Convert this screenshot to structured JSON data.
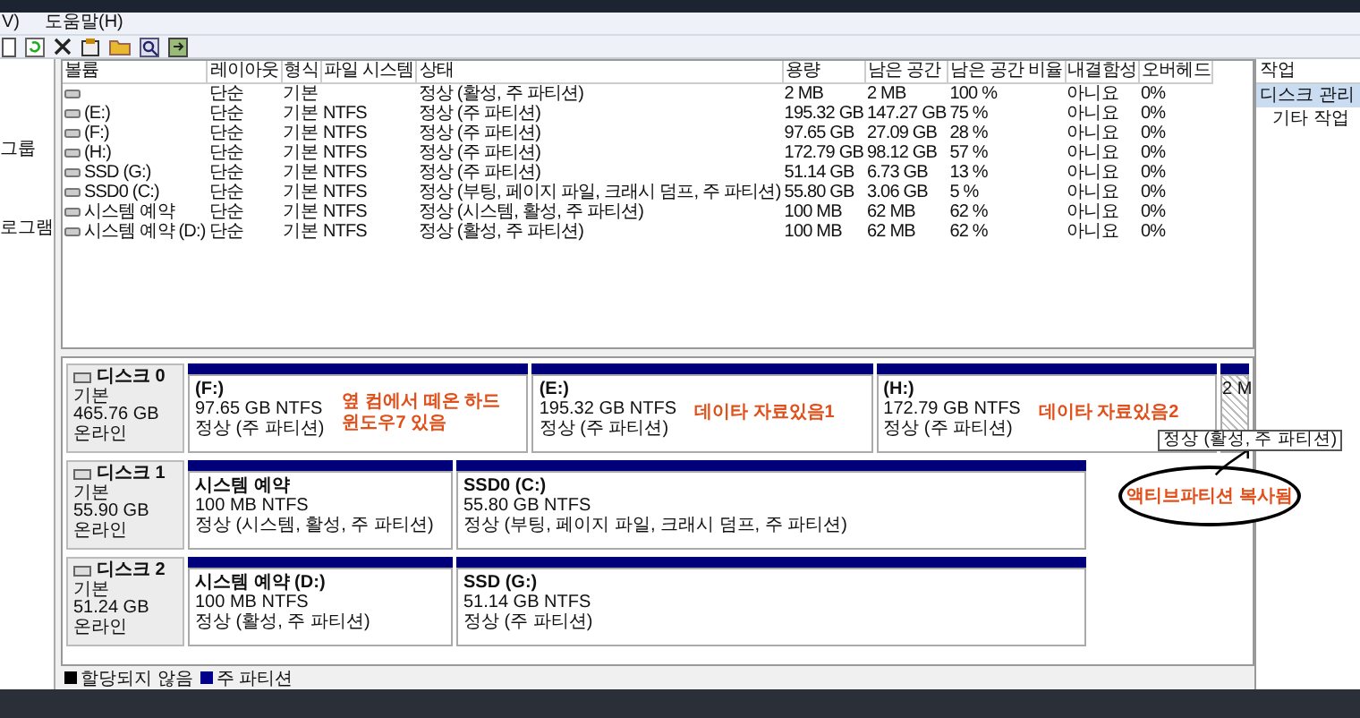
{
  "menu_bar": {
    "items": [
      "V)",
      "도움말(H)"
    ]
  },
  "nav_panel": {
    "items": [
      "그룹",
      "로그램"
    ]
  },
  "volume_table": {
    "columns": [
      "볼륨",
      "레이아웃",
      "형식",
      "파일 시스템",
      "상태",
      "용량",
      "남은 공간",
      "남은 공간 비율",
      "내결함성",
      "오버헤드"
    ],
    "rows": [
      {
        "layout": "단순",
        "type": "기본",
        "status": "정상 (활성, 주 파티션)",
        "capacity": "2 MB",
        "free_space": "2 MB",
        "free_percent": "100 %",
        "fault_tolerance": "아니요",
        "overhead": "0%"
      },
      {
        "volume": "(E:)",
        "layout": "단순",
        "type": "기본",
        "file_system": "NTFS",
        "status": "정상 (주 파티션)",
        "capacity": "195.32 GB",
        "free_space": "147.27 GB",
        "free_percent": "75 %",
        "fault_tolerance": "아니요",
        "overhead": "0%"
      },
      {
        "volume": "(F:)",
        "layout": "단순",
        "type": "기본",
        "file_system": "NTFS",
        "status": "정상 (주 파티션)",
        "capacity": "97.65 GB",
        "free_space": "27.09 GB",
        "free_percent": "28 %",
        "fault_tolerance": "아니요",
        "overhead": "0%"
      },
      {
        "volume": "(H:)",
        "layout": "단순",
        "type": "기본",
        "file_system": "NTFS",
        "status": "정상 (주 파티션)",
        "capacity": "172.79 GB",
        "free_space": "98.12 GB",
        "free_percent": "57 %",
        "fault_tolerance": "아니요",
        "overhead": "0%"
      },
      {
        "volume": "SSD (G:)",
        "layout": "단순",
        "type": "기본",
        "file_system": "NTFS",
        "status": "정상 (주 파티션)",
        "capacity": "51.14 GB",
        "free_space": "6.73 GB",
        "free_percent": "13 %",
        "fault_tolerance": "아니요",
        "overhead": "0%"
      },
      {
        "volume": "SSD0 (C:)",
        "layout": "단순",
        "type": "기본",
        "file_system": "NTFS",
        "status": "정상 (부팅, 페이지 파일, 크래시 덤프, 주 파티션)",
        "capacity": "55.80 GB",
        "free_space": "3.06 GB",
        "free_percent": "5 %",
        "fault_tolerance": "아니요",
        "overhead": "0%"
      },
      {
        "volume": "시스템 예약",
        "layout": "단순",
        "type": "기본",
        "file_system": "NTFS",
        "status": "정상 (시스템, 활성, 주 파티션)",
        "capacity": "100 MB",
        "free_space": "62 MB",
        "free_percent": "62 %",
        "fault_tolerance": "아니요",
        "overhead": "0%"
      },
      {
        "volume": "시스템 예약 (D:)",
        "layout": "단순",
        "type": "기본",
        "file_system": "NTFS",
        "status": "정상 (활성, 주 파티션)",
        "capacity": "100 MB",
        "free_space": "62 MB",
        "free_percent": "62 %",
        "fault_tolerance": "아니요",
        "overhead": "0%"
      }
    ]
  },
  "disks": [
    {
      "name": "디스크 0",
      "type": "기본",
      "size": "465.76 GB",
      "status": "온라인",
      "partitions": [
        {
          "name": "(F:)",
          "size": "97.65 GB NTFS",
          "status": "정상 (주 파티션)",
          "note": "옆 컴에서 떼온 하드\n윈도우7 있음",
          "selected": false
        },
        {
          "name": "(E:)",
          "size": "195.32 GB NTFS",
          "status": "정상 (주 파티션)",
          "note": "데이타 자료있음1",
          "selected": false
        },
        {
          "name": "(H:)",
          "size": "172.79 GB NTFS",
          "status": "정상 (주 파티션)",
          "note": "데이타 자료있음2",
          "selected": false
        },
        {
          "size": "2 M",
          "tooltip": "정상 (활성, 주 파티션)",
          "selected": true
        }
      ]
    },
    {
      "name": "디스크 1",
      "type": "기본",
      "size": "55.90 GB",
      "status": "온라인",
      "partitions": [
        {
          "name": "시스템 예약",
          "size": "100 MB NTFS",
          "status": "정상 (시스템, 활성, 주 파티션)",
          "selected": false
        },
        {
          "name": "SSD0  (C:)",
          "size": "55.80 GB NTFS",
          "status": "정상 (부팅, 페이지 파일, 크래시 덤프, 주 파티션)",
          "selected": false
        }
      ]
    },
    {
      "name": "디스크 2",
      "type": "기본",
      "size": "51.24 GB",
      "status": "온라인",
      "partitions": [
        {
          "name": "시스템 예약  (D:)",
          "size": "100 MB NTFS",
          "status": "정상 (활성, 주 파티션)",
          "selected": false
        },
        {
          "name": "SSD  (G:)",
          "size": "51.14 GB NTFS",
          "status": "정상 (주 파티션)",
          "selected": false
        }
      ]
    }
  ],
  "callout": {
    "text": "액티브파티션 복사됨"
  },
  "legend": [
    {
      "label": "할당되지 않음",
      "color": "#000000"
    },
    {
      "label": "주 파티션",
      "color": "#00008b"
    }
  ],
  "actions_panel": {
    "header": "작업",
    "items": [
      {
        "label": "디스크 관리",
        "selected": true
      },
      {
        "label": "기타 작업",
        "selected": false
      }
    ]
  }
}
